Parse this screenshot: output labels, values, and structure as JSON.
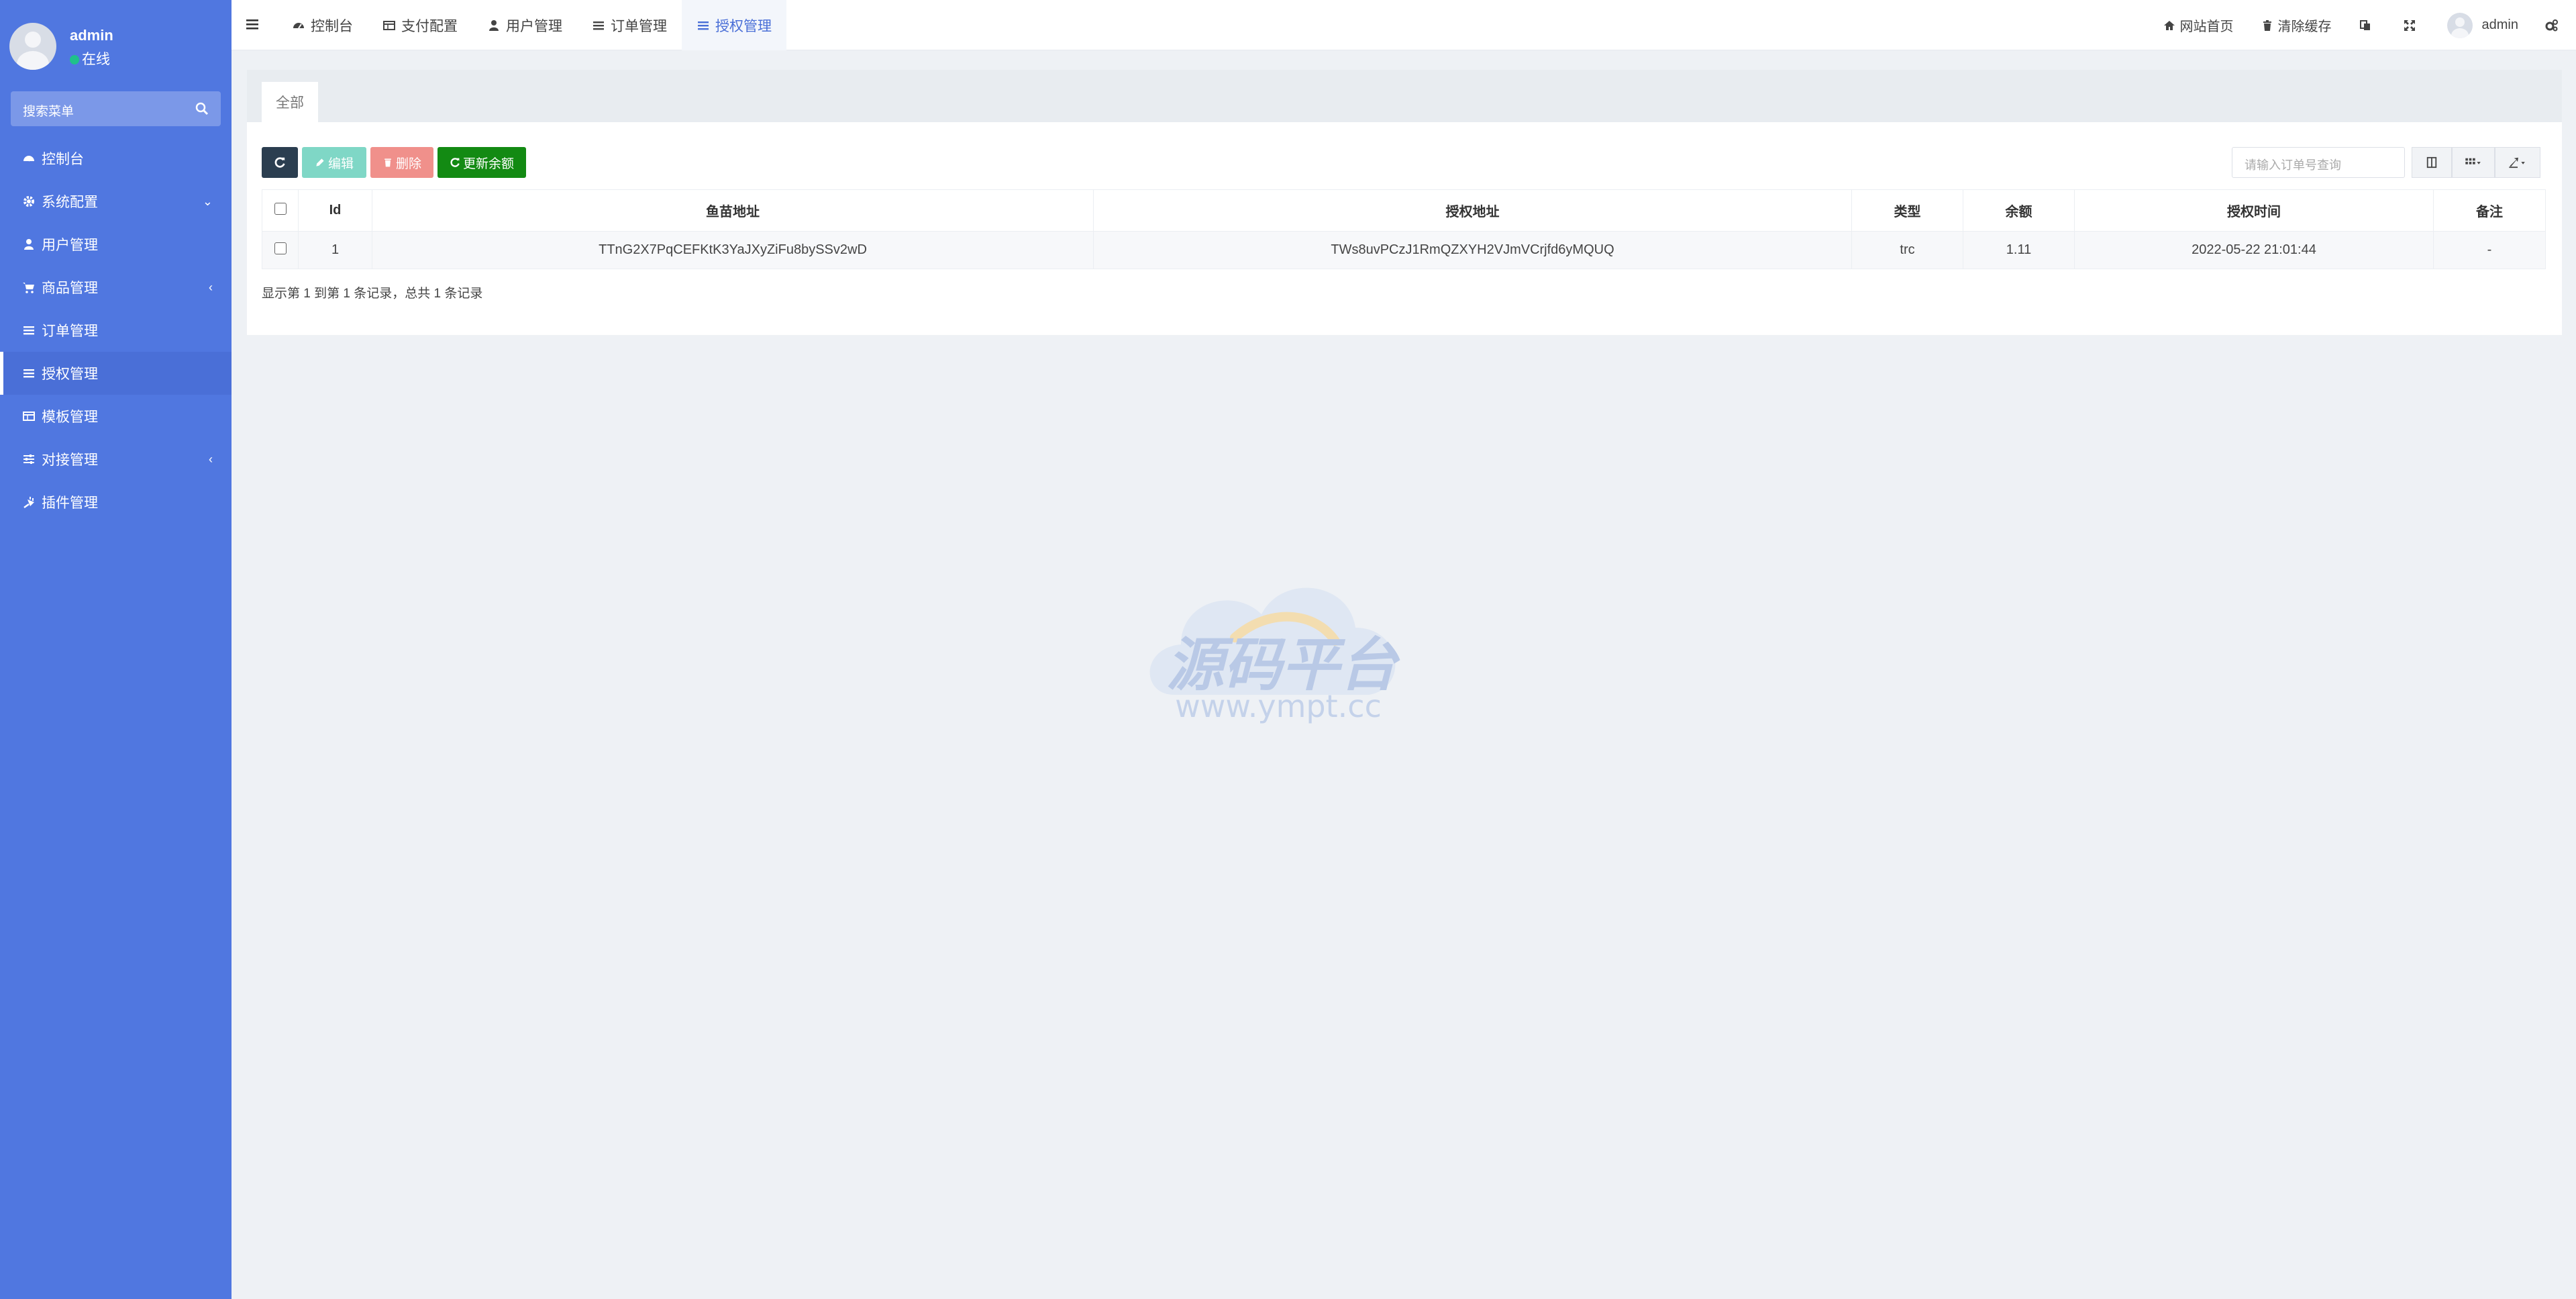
{
  "sidebar": {
    "user": {
      "name": "admin",
      "status": "在线"
    },
    "search_placeholder": "搜索菜单",
    "items": [
      {
        "label": "控制台",
        "icon": "dashboard-icon",
        "arrow": ""
      },
      {
        "label": "系统配置",
        "icon": "gear-icon",
        "arrow": "⌄"
      },
      {
        "label": "用户管理",
        "icon": "user-icon",
        "arrow": ""
      },
      {
        "label": "商品管理",
        "icon": "cart-icon",
        "arrow": "‹"
      },
      {
        "label": "订单管理",
        "icon": "list-icon",
        "arrow": ""
      },
      {
        "label": "授权管理",
        "icon": "list-icon",
        "arrow": ""
      },
      {
        "label": "模板管理",
        "icon": "table-icon",
        "arrow": ""
      },
      {
        "label": "对接管理",
        "icon": "sliders-icon",
        "arrow": "‹"
      },
      {
        "label": "插件管理",
        "icon": "plug-icon",
        "arrow": ""
      }
    ],
    "active_index": 5
  },
  "topbar": {
    "tabs": [
      {
        "label": "控制台",
        "icon": "dashboard-icon"
      },
      {
        "label": "支付配置",
        "icon": "table-icon"
      },
      {
        "label": "用户管理",
        "icon": "user-icon"
      },
      {
        "label": "订单管理",
        "icon": "list-icon"
      },
      {
        "label": "授权管理",
        "icon": "list-icon"
      }
    ],
    "active_tab": 4,
    "site_home": "网站首页",
    "clear_cache": "清除缓存",
    "user": "admin"
  },
  "panel": {
    "tab_all": "全部",
    "buttons": {
      "edit": "编辑",
      "delete": "删除",
      "update_balance": "更新余额"
    },
    "search_placeholder": "请输入订单号查询",
    "columns": [
      "Id",
      "鱼苗地址",
      "授权地址",
      "类型",
      "余额",
      "授权时间",
      "备注"
    ],
    "rows": [
      {
        "id": "1",
        "fish_address": "TTnG2X7PqCEFKtK3YaJXyZiFu8bySSv2wD",
        "auth_address": "TWs8uvPCzJ1RmQZXYH2VJmVCrjfd6yMQUQ",
        "type": "trc",
        "balance": "1.11",
        "auth_time": "2022-05-22 21:01:44",
        "note": "-"
      }
    ],
    "pager_text": "显示第 1 到第 1 条记录，总共 1 条记录"
  },
  "watermark": {
    "title": "源码平台",
    "url": "www.ympt.cc"
  }
}
